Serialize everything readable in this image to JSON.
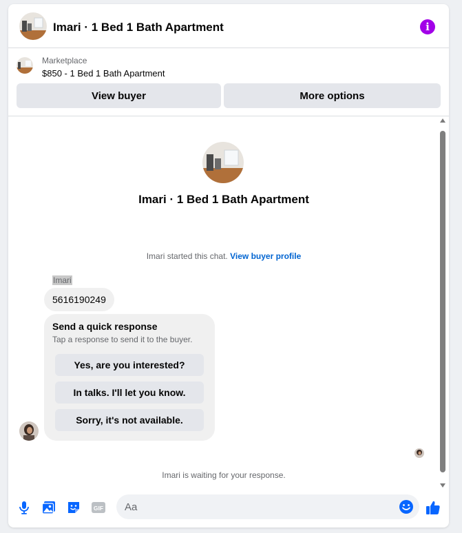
{
  "header": {
    "title": "Imari · 1 Bed 1 Bath Apartment",
    "info_icon": "info-icon",
    "accent": "#a200e8"
  },
  "listing": {
    "source": "Marketplace",
    "title": "$850 - 1 Bed 1 Bath Apartment",
    "view_buyer_label": "View buyer",
    "more_options_label": "More options"
  },
  "chat": {
    "hero_title": "Imari · 1 Bed 1 Bath Apartment",
    "started_text": "Imari started this chat.",
    "view_profile_link": "View buyer profile",
    "sender_name": "Imari",
    "message_text": "5616190249",
    "quick_response": {
      "title": "Send a quick response",
      "subtitle": "Tap a response to send it to the buyer.",
      "options": [
        "Yes, are you interested?",
        "In talks. I'll let you know.",
        "Sorry, it's not available."
      ]
    },
    "waiting_text": "Imari is waiting for your response."
  },
  "composer": {
    "placeholder": "Aa",
    "icons": [
      "microphone-icon",
      "photo-icon",
      "sticker-icon",
      "gif-icon",
      "emoji-icon",
      "like-icon"
    ],
    "gif_label": "GIF",
    "accent": "#0866ff"
  }
}
